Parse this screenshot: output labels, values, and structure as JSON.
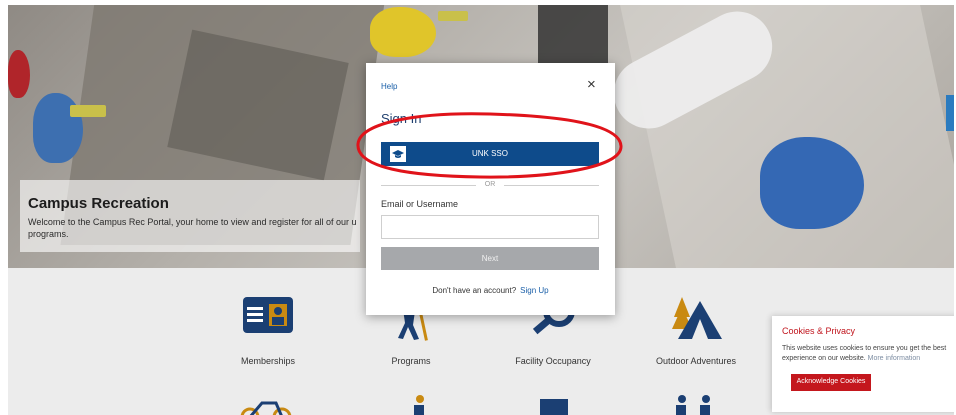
{
  "hero": {
    "title": "Campus Recreation",
    "text": "Welcome to the Campus Rec Portal, your home to view and register for all of our u programs."
  },
  "tiles": [
    {
      "label": "Memberships",
      "icon": "id-card-icon"
    },
    {
      "label": "Programs",
      "icon": "hiker-icon"
    },
    {
      "label": "Facility Occupancy",
      "icon": "magnifier-icon"
    },
    {
      "label": "Outdoor Adventures",
      "icon": "tent-icon"
    }
  ],
  "modal": {
    "help": "Help",
    "close": "×",
    "title": "Sign In",
    "sso_label": "UNK SSO",
    "or": "OR",
    "field_label": "Email or Username",
    "next": "Next",
    "no_account": "Don't have an account?",
    "signup": "Sign Up"
  },
  "cookies": {
    "title": "Cookies & Privacy",
    "text": "This website uses cookies to ensure you get the best experience on our website.",
    "more": "More information",
    "button": "Acknowledge Cookies"
  },
  "colors": {
    "brand_blue": "#0e4b8b",
    "next_gray": "#a6a8ab",
    "annotation_red": "#e0131a",
    "cookie_red": "#c4171d",
    "icon_navy": "#1b3f73",
    "icon_gold": "#c98a12"
  }
}
